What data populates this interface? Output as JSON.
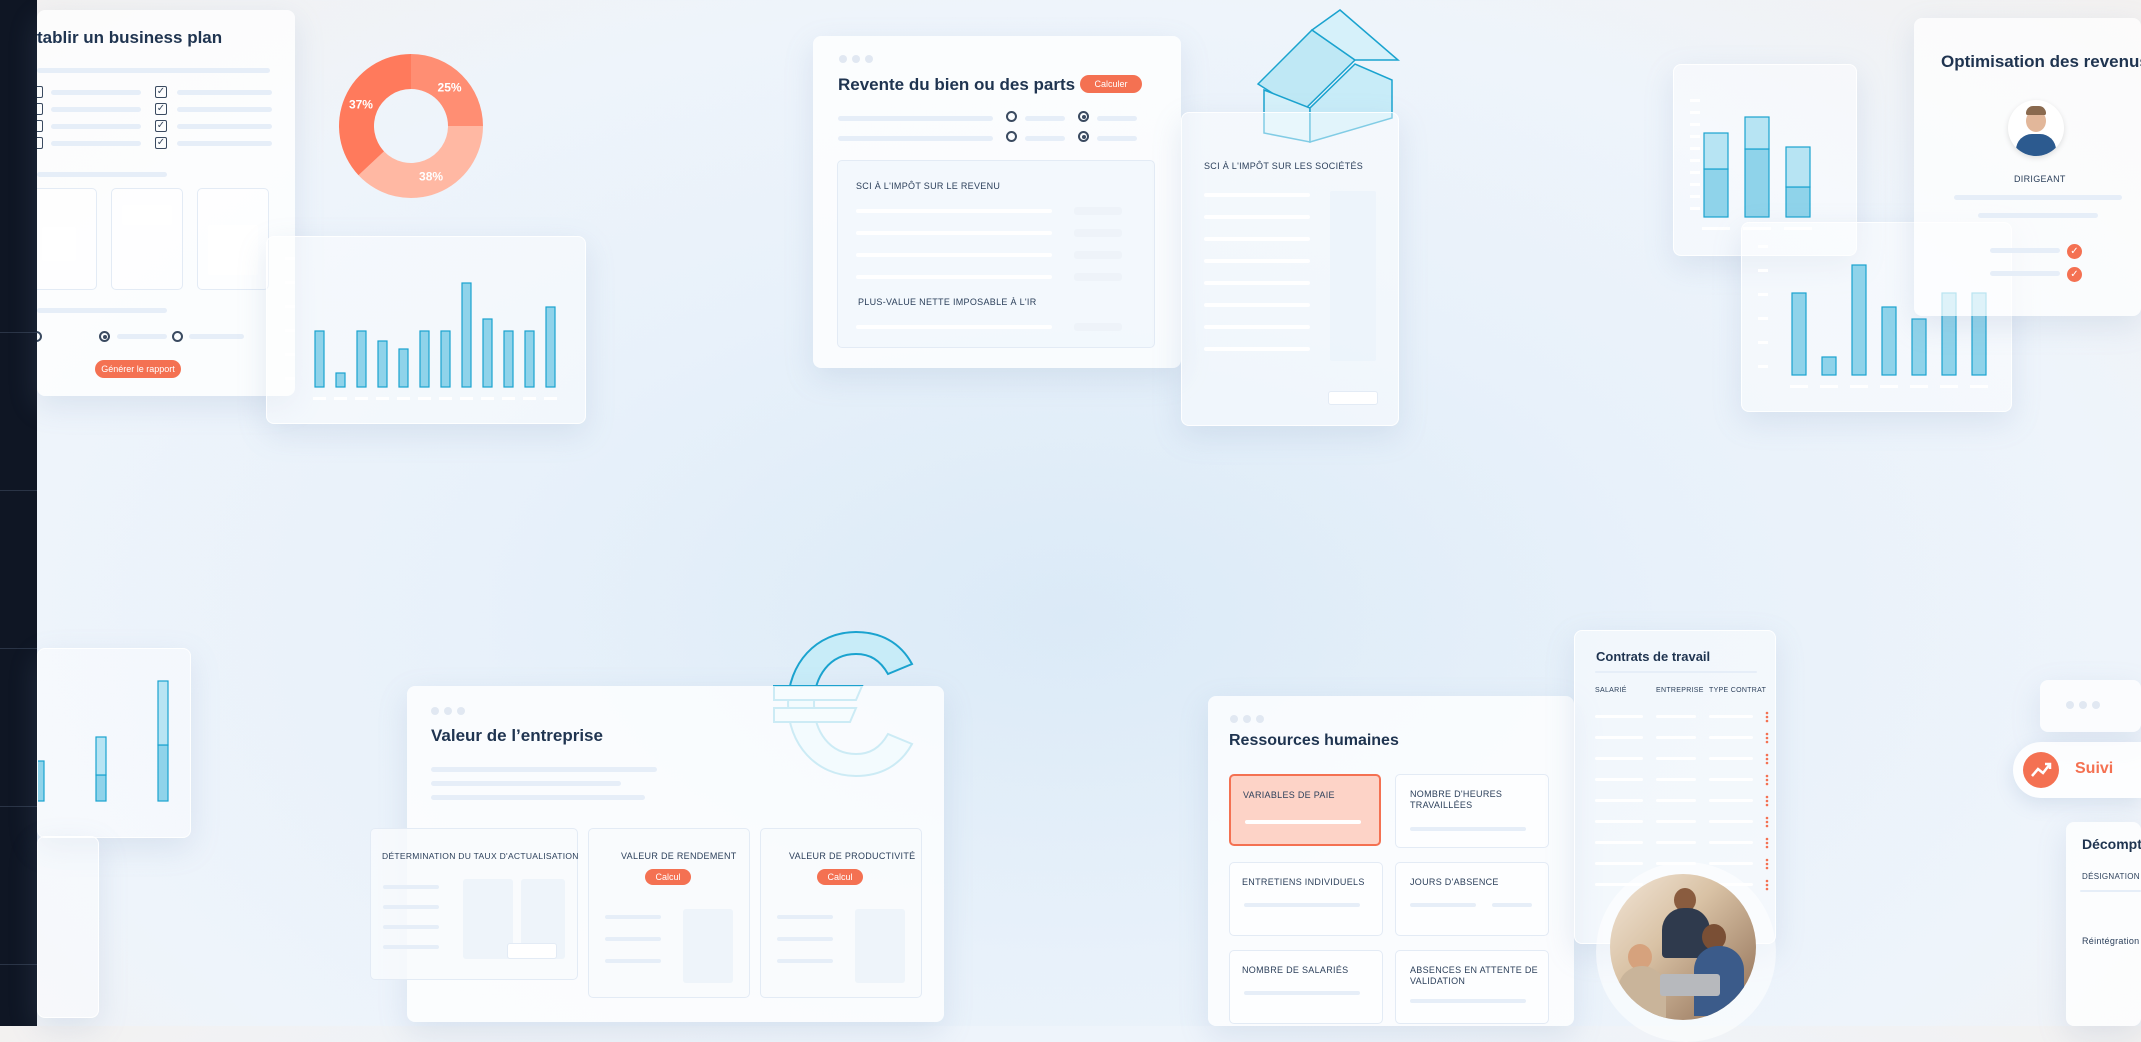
{
  "colors": {
    "accent": "#f47152",
    "bar_fill": "#8fd3ea",
    "bar_stroke": "#1aa3cf",
    "text": "#1f3450"
  },
  "business_plan": {
    "title": "tablir un business plan",
    "button": "Générer le rapport"
  },
  "donut": {
    "slices": [
      {
        "label": "25%",
        "value": 25,
        "color": "#ff8e73"
      },
      {
        "label": "38%",
        "value": 38,
        "color": "#ffb8a3"
      },
      {
        "label": "37%",
        "value": 37,
        "color": "#ff7a5c"
      }
    ]
  },
  "revente": {
    "title": "Revente du bien ou des parts",
    "button": "Calculer",
    "section1": "SCI À L'IMPÔT SUR LE REVENU",
    "section2": "PLUS-VALUE NETTE IMPOSABLE À L'IR"
  },
  "societes": {
    "label": "SCI À L'IMPÔT SUR LES SOCIÉTÉS"
  },
  "optimisation": {
    "title": "Optimisation des revenus",
    "role": "DIRIGEANT"
  },
  "valeur": {
    "title": "Valeur de l’entreprise",
    "col1": "DÉTERMINATION DU TAUX D'ACTUALISATION",
    "col2": "VALEUR DE RENDEMENT",
    "col3": "VALEUR DE PRODUCTIVITÉ",
    "calc": "Calcul"
  },
  "rh": {
    "title": "Ressources humaines",
    "tiles": [
      "VARIABLES DE PAIE",
      "NOMBRE D'HEURES TRAVAILLÉES",
      "ENTRETIENS INDIVIDUELS",
      "JOURS D'ABSENCE",
      "NOMBRE DE SALARIÉS",
      "ABSENCES EN ATTENTE DE VALIDATION"
    ]
  },
  "contrats": {
    "title": "Contrats de travail",
    "cols": [
      "SALARIÉ",
      "ENTREPRISE",
      "TYPE CONTRAT"
    ]
  },
  "suivi": {
    "label": "Suivi"
  },
  "decompte": {
    "title": "Décompte",
    "col": "DÉSIGNATION",
    "row": "Réintégration"
  }
}
